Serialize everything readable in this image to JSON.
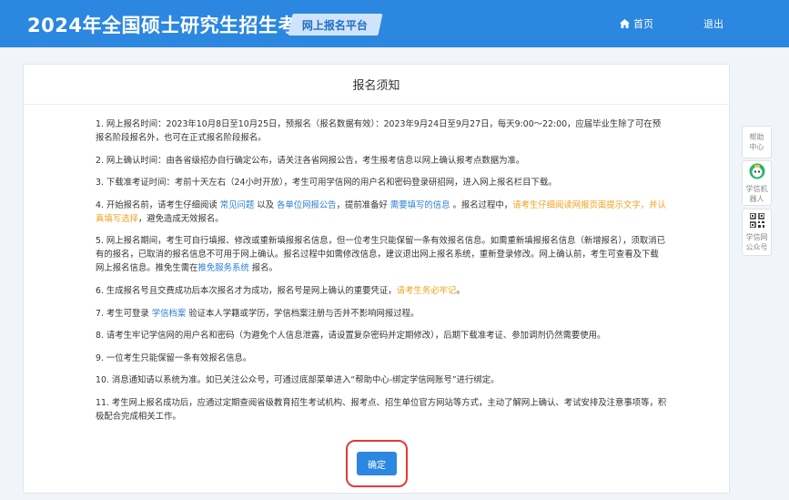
{
  "header": {
    "site_title": "2024年全国硕士研究生招生考试",
    "platform_tag": "网上报名平台",
    "nav_home": "首页",
    "nav_logout": "退出"
  },
  "panel": {
    "title": "报名须知",
    "confirm_label": "确定"
  },
  "notices": [
    {
      "a": "1. 网上报名时间：2023年10月8日至10月25日，预报名（报名数据有效）：2023年9月24日至9月27日，每天9:00～22:00，应届毕业生除了可在预报名阶段报名外，也可在正式报名阶段报名。"
    },
    {
      "a": "2. 网上确认时间：由各省级招办自行确定公布，请关注各省网报公告，考生报考信息以网上确认报考点数据为准。"
    },
    {
      "a": "3. 下载准考证时间：考前十天左右（24小时开放），考生可用学信网的用户名和密码登录研招网，进入网上报名栏目下载。"
    },
    {
      "a": "4. 开始报名前，请考生仔细阅读 ",
      "l1": "常见问题",
      "b": " 以及 ",
      "l2": "各单位网报公告",
      "c": "，提前准备好 ",
      "l3": "需要填写的信息",
      "d": " 。报名过程中，",
      "w": "请考生仔细阅读网报页面提示文字，并认真填写选择",
      "e": "，避免造成无效报名。"
    },
    {
      "a": "5. 网上报名期间，考生可自行填报、修改或重新填报报名信息，但一位考生只能保留一条有效报名信息。如需重新填报报名信息（新增报名），须取消已有的报名，已取消的报名信息不可用于网上确认。报名过程中如需修改信息，建议退出网上报名系统，重新登录修改。网上确认前，考生可查看及下载网上报名信息。推免生需在",
      "l1": "推免服务系统",
      "b": " 报名。"
    },
    {
      "a": "6. 生成报名号且交费成功后本次报名才为成功，报名号是网上确认的重要凭证，",
      "w": "请考生务必牢记",
      "b": "。"
    },
    {
      "a": "7. 考生可登录 ",
      "l1": "学信档案",
      "b": " 验证本人学籍或学历，学信档案注册与否并不影响网报过程。"
    },
    {
      "a": "8. 请考生牢记学信网的用户名和密码（为避免个人信息泄露，请设置复杂密码并定期修改），后期下载准考证、参加调剂仍然需要使用。"
    },
    {
      "a": "9. 一位考生只能保留一条有效报名信息。"
    },
    {
      "a": "10. 消息通知请以系统为准。如已关注公众号，可通过底部菜单进入“帮助中心-绑定学信网账号”进行绑定。"
    },
    {
      "a": "11. 考生网上报名成功后，应通过定期查阅省级教育招生考试机构、报考点、招生单位官方网站等方式，主动了解网上确认、考试安排及注意事项等，积极配合完成相关工作。"
    }
  ],
  "side": {
    "help": "帮助中心",
    "robot": "学信机器人",
    "qr": "学信网公众号"
  }
}
